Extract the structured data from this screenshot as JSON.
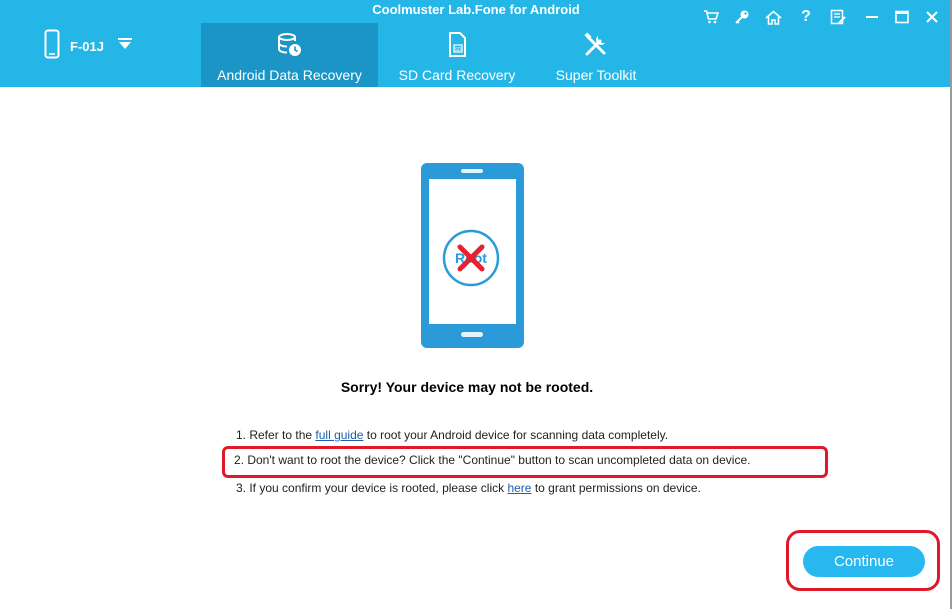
{
  "window": {
    "title": "Coolmuster Lab.Fone for Android"
  },
  "device": {
    "name": "F-01J"
  },
  "tabs": [
    {
      "label": "Android Data Recovery",
      "active": true
    },
    {
      "label": "SD Card Recovery",
      "active": false
    },
    {
      "label": "Super Toolkit",
      "active": false
    }
  ],
  "window_controls": [
    "cart-icon",
    "key-icon",
    "home-icon",
    "help-icon",
    "feedback-icon",
    "minimize-icon",
    "maximize-icon",
    "close-icon"
  ],
  "phone_illustration": {
    "badge_text": "Root"
  },
  "message": {
    "heading": "Sorry! Your device may not be rooted.",
    "step1_prefix": "1. Refer to the ",
    "step1_link": "full guide",
    "step1_suffix": " to root your Android device for scanning data completely.",
    "step2": "2. Don't want to root the device? Click the \"Continue\" button to scan uncompleted data on device.",
    "step3_prefix": "3. If you confirm your device is rooted, please click ",
    "step3_link": "here",
    "step3_suffix": " to grant permissions on device."
  },
  "continue_button": {
    "label": "Continue"
  },
  "colors": {
    "header": "#25b6e8",
    "active_tab": "#1b94c6",
    "accent": "#26b8ee",
    "highlight": "#e0192a",
    "link": "#1b5fb0"
  }
}
